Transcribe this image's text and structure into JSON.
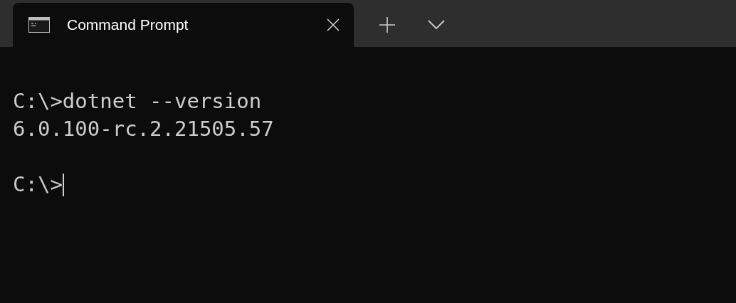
{
  "tabs": [
    {
      "title": "Command Prompt",
      "selected": true
    }
  ],
  "terminal": {
    "lines": [
      {
        "kind": "text",
        "text": "C:\\>dotnet --version",
        "cursor": false
      },
      {
        "kind": "text",
        "text": "6.0.100-rc.2.21505.57",
        "cursor": false
      },
      {
        "kind": "blank"
      },
      {
        "kind": "text",
        "text": "C:\\>",
        "cursor": true
      }
    ]
  }
}
